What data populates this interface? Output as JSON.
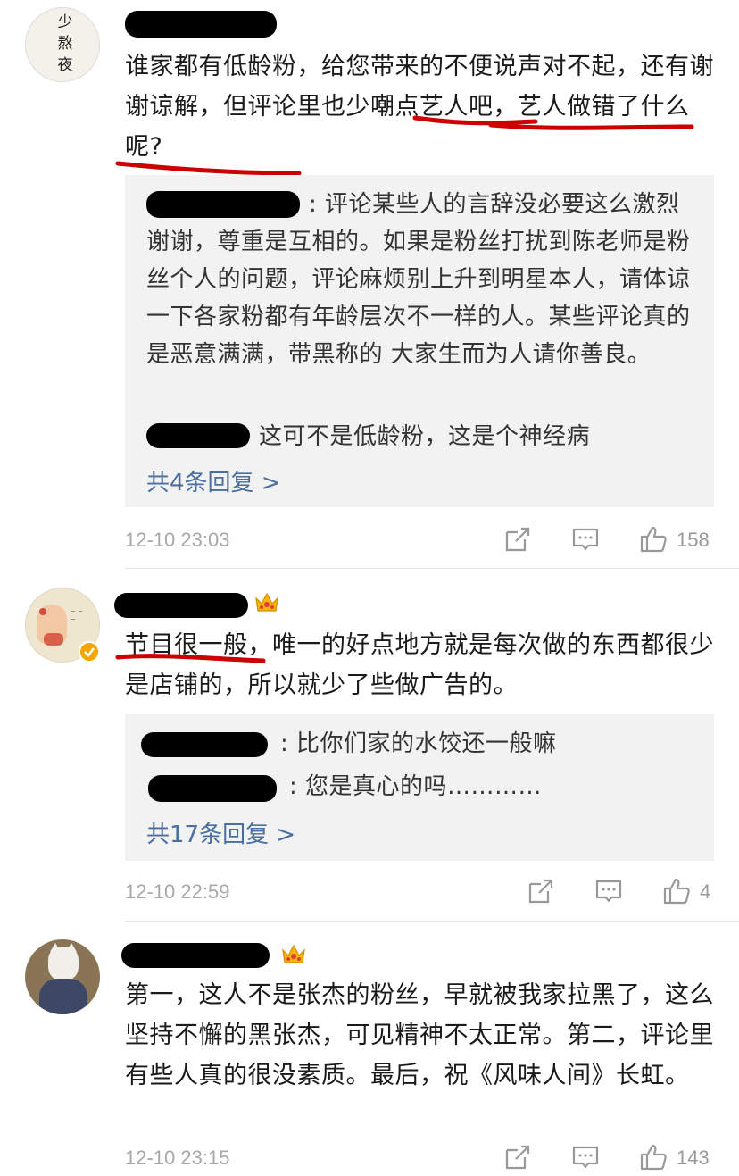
{
  "comments": [
    {
      "text": "谁家都有低龄粉，给您带来的不便说声对不起，还有谢谢谅解，但评论里也少嘲点艺人吧，艺人做错了什么呢?",
      "avatar_text": [
        "少",
        "熬",
        "夜"
      ],
      "replies": [
        ": 评论某些人的言辞没必要这么激烈谢谢，尊重是互相的。如果是粉丝打扰到陈老师是粉丝个人的问题，评论麻烦别上升到明星本人，请体谅一下各家粉都有年龄层次不一样的人。某些评论真的是恶意满满，带黑称的 大家生而为人请你善良。",
        "这可不是低龄粉，这是个神经病"
      ],
      "more_replies": "共4条回复 >",
      "time": "12-10 23:03",
      "likes": "158"
    },
    {
      "text": "节目很一般，唯一的好点地方就是每次做的东西都很少是店铺的，所以就少了些做广告的。",
      "replies": [
        ": 比你们家的水饺还一般嘛",
        ": 您是真心的吗…………"
      ],
      "more_replies": "共17条回复 >",
      "time": "12-10 22:59",
      "likes": "4"
    },
    {
      "text": "第一，这人不是张杰的粉丝，早就被我家拉黑了，这么坚持不懈的黑张杰，可见精神不太正常。第二，评论里有些人真的很没素质。最后，祝《风味人间》长虹。",
      "time": "12-10 23:15",
      "likes": "143"
    }
  ],
  "colors": {
    "link": "#4a6f9f",
    "underline": "#cc0000",
    "reply_bg": "#f2f2f2",
    "meta": "#a8a8a8"
  }
}
